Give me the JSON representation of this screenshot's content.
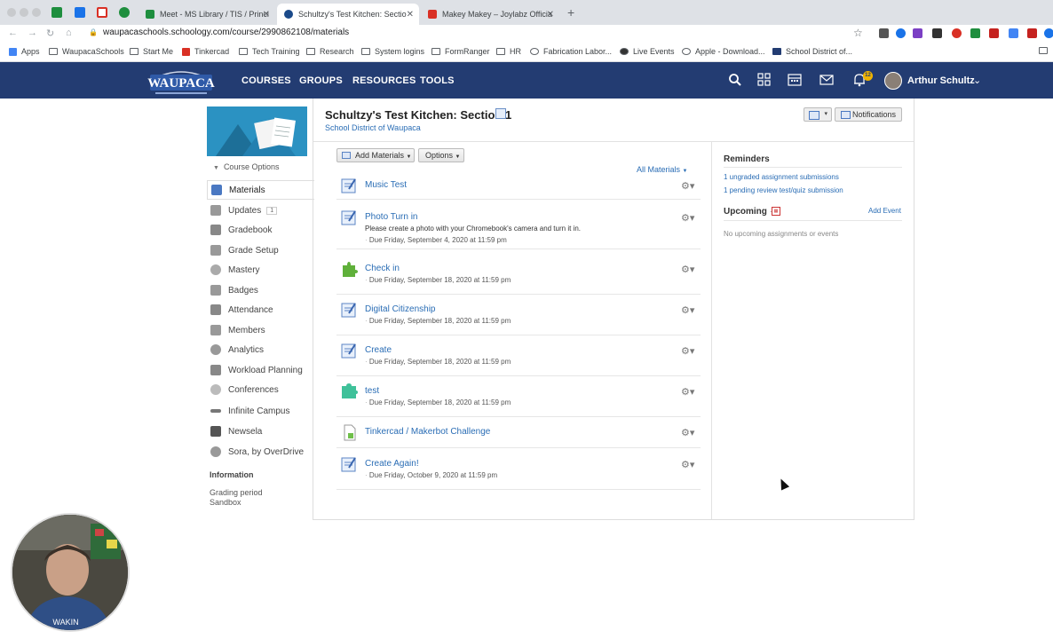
{
  "browser": {
    "tabs": [
      {
        "label": "Meet - MS Library / TIS / Princi",
        "color": "#1e8e3e"
      },
      {
        "label": "Schultzy's Test Kitchen: Sectio",
        "color": "#1b4a8a"
      },
      {
        "label": "Makey Makey – Joylabz Officia",
        "color": "#d93025"
      }
    ],
    "url": "waupacaschools.schoology.com/course/2990862108/materials",
    "bookmarks": [
      "Apps",
      "WaupacaSchools",
      "Start Me",
      "Tinkercad",
      "Tech Training",
      "Research",
      "System logins",
      "FormRanger",
      "HR",
      "Fabrication Labor...",
      "Live Events",
      "Apple - Download...",
      "School District of..."
    ]
  },
  "header": {
    "logo_text": "WAUPACA",
    "nav": [
      "COURSES",
      "GROUPS",
      "RESOURCES",
      "TOOLS"
    ],
    "notification_count": "12",
    "user_name": "Arthur Schultz",
    "colors": {
      "bar": "#233c72"
    }
  },
  "sidebar": {
    "course_options": "Course Options",
    "items": [
      {
        "label": "Materials",
        "icon": "materials-icon",
        "color": "#4a78c2"
      },
      {
        "label": "Updates",
        "icon": "updates-icon",
        "color": "#999",
        "badge": "1"
      },
      {
        "label": "Gradebook",
        "icon": "gradebook-icon",
        "color": "#888"
      },
      {
        "label": "Grade Setup",
        "icon": "grade-setup-icon",
        "color": "#999"
      },
      {
        "label": "Mastery",
        "icon": "mastery-icon",
        "color": "#aaa"
      },
      {
        "label": "Badges",
        "icon": "badges-icon",
        "color": "#999"
      },
      {
        "label": "Attendance",
        "icon": "attendance-icon",
        "color": "#888"
      },
      {
        "label": "Members",
        "icon": "members-icon",
        "color": "#999"
      },
      {
        "label": "Analytics",
        "icon": "analytics-icon",
        "color": "#999"
      },
      {
        "label": "Workload Planning",
        "icon": "workload-icon",
        "color": "#888"
      },
      {
        "label": "Conferences",
        "icon": "conferences-icon",
        "color": "#bbb"
      },
      {
        "label": "Infinite Campus",
        "icon": "infinite-campus-icon",
        "color": "#777"
      },
      {
        "label": "Newsela",
        "icon": "newsela-icon",
        "color": "#555"
      },
      {
        "label": "Sora, by OverDrive",
        "icon": "sora-icon",
        "color": "#999"
      }
    ],
    "info_heading": "Information",
    "grading_period_label": "Grading period",
    "grading_period_value": "Sandbox"
  },
  "course": {
    "title": "Schultzy's Test Kitchen: Section 1",
    "subtitle": "School District of Waupaca",
    "notifications_label": "Notifications",
    "add_materials_label": "Add Materials",
    "options_label": "Options",
    "filter_label": "All Materials"
  },
  "materials": [
    {
      "title": "Music Test",
      "desc": "",
      "due": "",
      "icon": "assignment-icon"
    },
    {
      "title": "Photo Turn in",
      "desc": "Please create a photo with your Chromebook's camera and turn it in.",
      "due": "Due Friday, September 4, 2020 at 11:59 pm",
      "icon": "assignment-icon"
    },
    {
      "title": "Check in",
      "desc": "",
      "due": "Due Friday, September 18, 2020 at 11:59 pm",
      "icon": "puzzle-icon"
    },
    {
      "title": "Digital Citizenship",
      "desc": "",
      "due": "Due Friday, September 18, 2020 at 11:59 pm",
      "icon": "assignment-icon"
    },
    {
      "title": "Create",
      "desc": "",
      "due": "Due Friday, September 18, 2020 at 11:59 pm",
      "icon": "assignment-icon"
    },
    {
      "title": "test",
      "desc": "",
      "due": "Due Friday, September 18, 2020 at 11:59 pm",
      "icon": "puzzle-icon"
    },
    {
      "title": "Tinkercad / Makerbot Challenge",
      "desc": "",
      "due": "",
      "icon": "file-icon"
    },
    {
      "title": "Create Again!",
      "desc": "",
      "due": "Due Friday, October 9, 2020 at 11:59 pm",
      "icon": "assignment-icon"
    }
  ],
  "right": {
    "reminders_heading": "Reminders",
    "reminder_links": [
      "1 ungraded assignment submissions",
      "1 pending review test/quiz submission"
    ],
    "upcoming_heading": "Upcoming",
    "add_event_label": "Add Event",
    "no_upcoming": "No upcoming assignments or events"
  }
}
